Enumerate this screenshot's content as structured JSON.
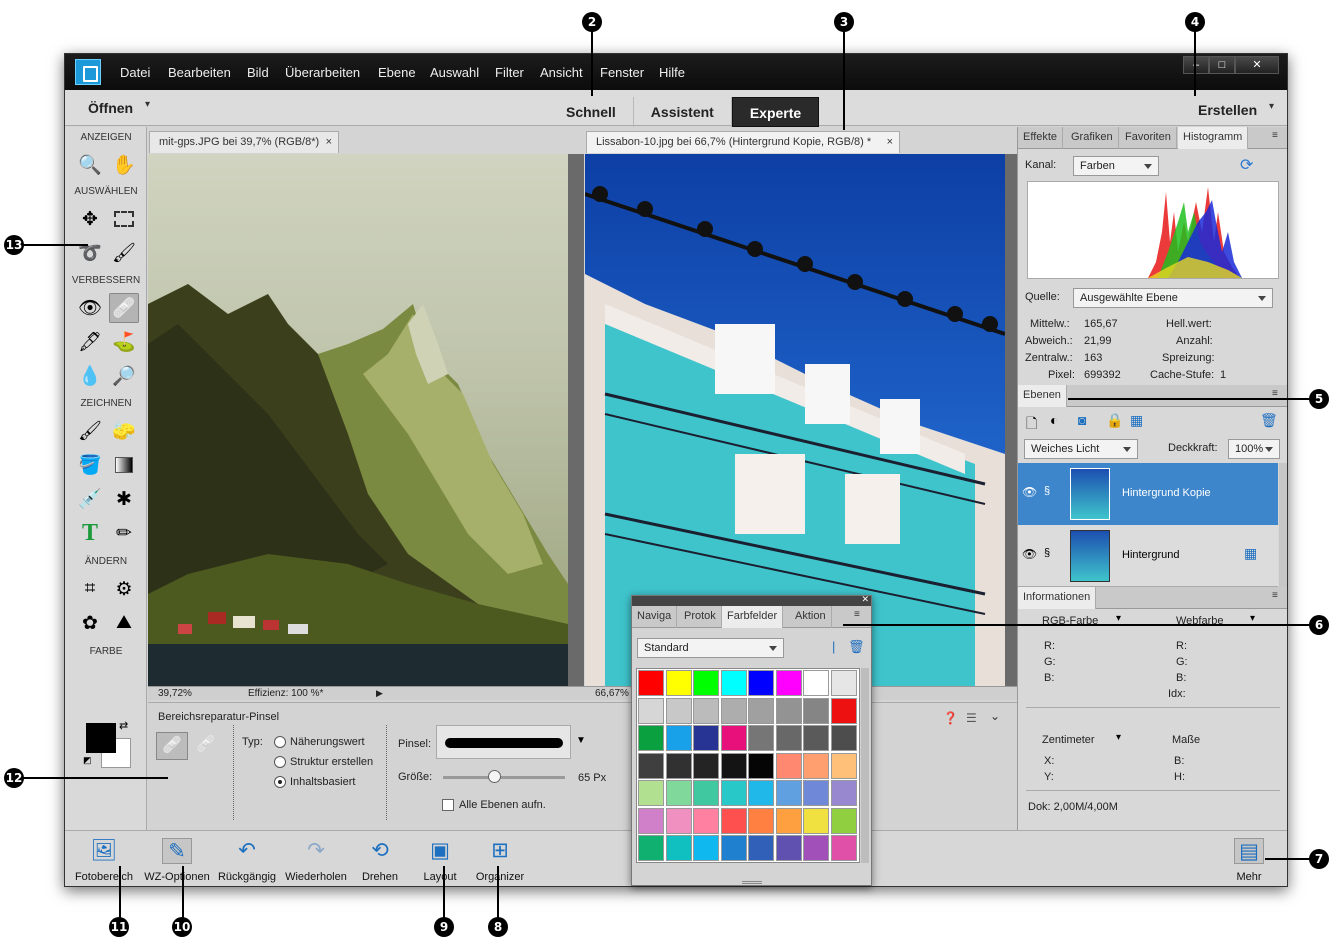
{
  "menu": {
    "items": [
      "Datei",
      "Bearbeiten",
      "Bild",
      "Überarbeiten",
      "Ebene",
      "Auswahl",
      "Filter",
      "Ansicht",
      "Fenster",
      "Hilfe"
    ],
    "win_min": "–",
    "win_max": "□",
    "win_close": "✕"
  },
  "topbar": {
    "open": "Öffnen",
    "modes": [
      "Schnell",
      "Assistent",
      "Experte"
    ],
    "create": "Erstellen"
  },
  "toolbox": {
    "sections": [
      "ANZEIGEN",
      "AUSWÄHLEN",
      "VERBESSERN",
      "ZEICHNEN",
      "ÄNDERN",
      "FARBE"
    ]
  },
  "docs": [
    {
      "tab": "mit-gps.JPG bei 39,7% (RGB/8*)",
      "zoom": "39,72%",
      "status": "Effizienz: 100 %*"
    },
    {
      "tab": "Lissabon-10.jpg bei 66,7% (Hintergrund Kopie, RGB/8) *",
      "zoom": "66,67%"
    }
  ],
  "tab_close": "×",
  "options": {
    "tool_name": "Bereichsreparatur-Pinsel",
    "typ_label": "Typ:",
    "types": [
      "Näherungswert",
      "Struktur erstellen",
      "Inhaltsbasiert"
    ],
    "brush_label": "Pinsel:",
    "size_label": "Größe:",
    "size_value": "65 Px",
    "size_fraction": 0.42,
    "all_layers": "Alle Ebenen aufn."
  },
  "bottom": [
    "Fotobereich",
    "WZ-Optionen",
    "Rückgängig",
    "Wiederholen",
    "Drehen",
    "Layout",
    "Organizer",
    "Mehr"
  ],
  "panel_top": {
    "tabs": [
      "Effekte",
      "Grafiken",
      "Favoriten",
      "Histogramm"
    ],
    "kanal_label": "Kanal:",
    "kanal_value": "Farben",
    "quelle_label": "Quelle:",
    "quelle_value": "Ausgewählte Ebene",
    "stats_left": [
      [
        "Mittelw.:",
        "165,67"
      ],
      [
        "Abweich.:",
        "21,99"
      ],
      [
        "Zentralw.:",
        "163"
      ],
      [
        "Pixel:",
        "699392"
      ]
    ],
    "stats_right": [
      [
        "Hell.wert:",
        ""
      ],
      [
        "Anzahl:",
        ""
      ],
      [
        "Spreizung:",
        ""
      ],
      [
        "Cache-Stufe:",
        "1"
      ]
    ]
  },
  "layers": {
    "tab": "Ebenen",
    "blend": "Weiches Licht",
    "opacity_label": "Deckkraft:",
    "opacity_value": "100%",
    "items": [
      "Hintergrund Kopie",
      "Hintergrund"
    ]
  },
  "info": {
    "tab": "Informationen",
    "col1": "RGB-Farbe",
    "col2": "Webfarbe",
    "rgb": [
      "R:",
      "G:",
      "B:"
    ],
    "web": [
      "R:",
      "G:",
      "B:",
      "Idx:"
    ],
    "unit": "Zentimeter",
    "mass": "Maße",
    "xy": [
      "X:",
      "Y:"
    ],
    "bh": [
      "B:",
      "H:"
    ],
    "doc": "Dok: 2,00M/4,00M"
  },
  "floating": {
    "tabs": [
      "Naviga",
      "Protok",
      "Farbfelder",
      "Aktion"
    ],
    "preset": "Standard",
    "close": "✕",
    "swatches": [
      "#ff0000",
      "#ffff00",
      "#00ff00",
      "#00ffff",
      "#0000ff",
      "#ff00ff",
      "#ffffff",
      "#e6e6e6",
      "#d6d6d6",
      "#c8c8c8",
      "#bbbbbb",
      "#adadad",
      "#a0a0a0",
      "#939393",
      "#858585",
      "#ee1111",
      "#0aa040",
      "#18a0e8",
      "#283494",
      "#e8107a",
      "#767676",
      "#686868",
      "#5a5a5a",
      "#4d4d4d",
      "#3f3f3f",
      "#313131",
      "#242424",
      "#141414",
      "#050505",
      "#ff8870",
      "#ff9e6e",
      "#ffc07a",
      "#b0e090",
      "#80d89a",
      "#40c8a0",
      "#28c8c8",
      "#20b8e8",
      "#60a0e0",
      "#7088d8",
      "#9888d0",
      "#d080c8",
      "#f090c0",
      "#ff80a0",
      "#ff5050",
      "#ff8040",
      "#ffa040",
      "#f0e040",
      "#90d040",
      "#10b070",
      "#10c0c0",
      "#10b8f0",
      "#2080d0",
      "#3060b8",
      "#6050b0",
      "#a050b8",
      "#e050a8"
    ]
  },
  "callouts": [
    "2",
    "3",
    "4",
    "5",
    "6",
    "7",
    "8",
    "9",
    "10",
    "11",
    "12",
    "13"
  ]
}
